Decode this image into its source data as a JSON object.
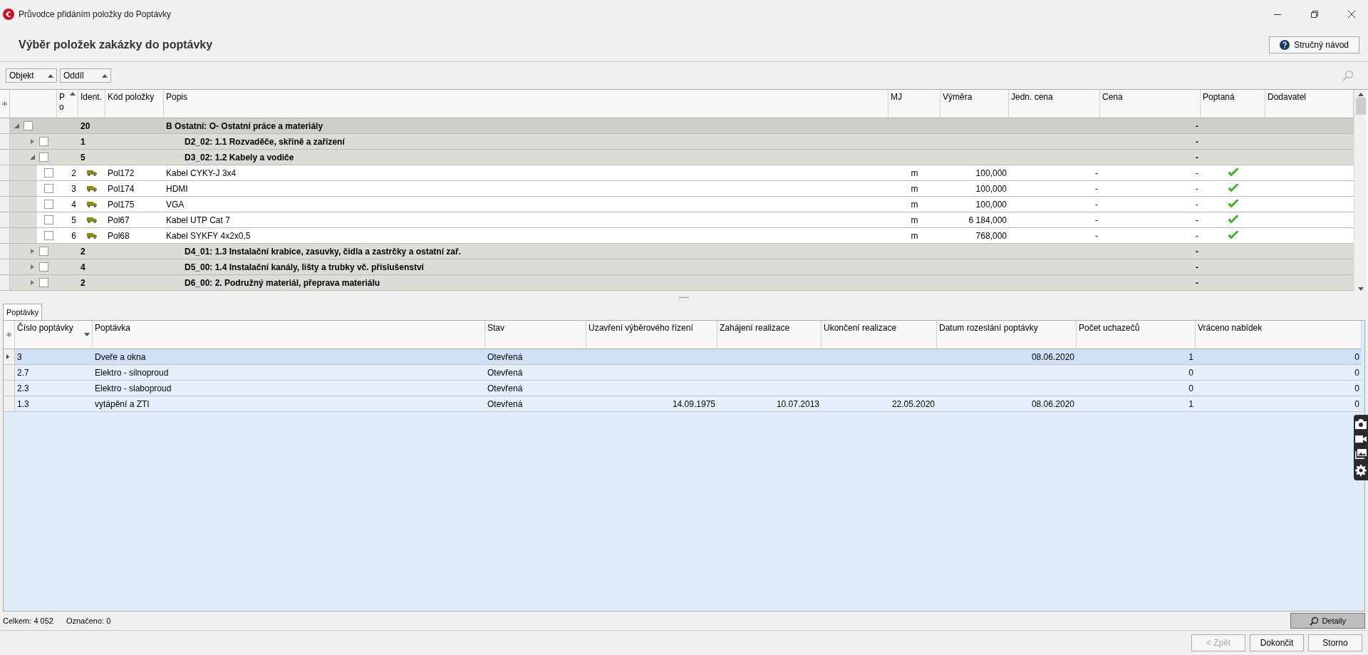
{
  "window": {
    "title": "Průvodce přidáním položky do Poptávky"
  },
  "heading": "Výběr položek zakázky do poptávky",
  "help_button": "Stručný návod",
  "filters": [
    {
      "label": "Objekt"
    },
    {
      "label": "Oddíl"
    }
  ],
  "items_table": {
    "columns": [
      "P o",
      "Ident.",
      "Kód položky",
      "Popis",
      "MJ",
      "Výměra",
      "Jedn. cena",
      "Cena",
      "Poptaná",
      "Dodavatel"
    ],
    "rows": [
      {
        "kind": "group",
        "checked": false,
        "expanded": true,
        "count": "20",
        "popis": "B Ostatní: O- Ostatní práce a materiály",
        "cena": "-",
        "children": [
          {
            "kind": "group",
            "checked": false,
            "expanded": false,
            "count": "1",
            "popis": "D2_02: 1.1 Rozvaděče, skříně a zařízení",
            "cena": "-"
          },
          {
            "kind": "group",
            "checked": false,
            "expanded": true,
            "count": "5",
            "popis": "D3_02: 1.2 Kabely a vodiče",
            "cena": "-",
            "children": [
              {
                "kind": "item",
                "checked": false,
                "po": "2",
                "kod": "Pol172",
                "popis": "Kabel CYKY-J 3x4",
                "mj": "m",
                "vymera": "100,000",
                "jedn_cena": "-",
                "cena": "-",
                "poptana": true
              },
              {
                "kind": "item",
                "checked": false,
                "po": "3",
                "kod": "Pol174",
                "popis": "HDMI",
                "mj": "m",
                "vymera": "100,000",
                "jedn_cena": "-",
                "cena": "-",
                "poptana": true
              },
              {
                "kind": "item",
                "checked": false,
                "po": "4",
                "kod": "Pol175",
                "popis": "VGA",
                "mj": "m",
                "vymera": "100,000",
                "jedn_cena": "-",
                "cena": "-",
                "poptana": true
              },
              {
                "kind": "item",
                "checked": false,
                "po": "5",
                "kod": "Pol67",
                "popis": "Kabel UTP Cat 7",
                "mj": "m",
                "vymera": "6 184,000",
                "jedn_cena": "-",
                "cena": "-",
                "poptana": true
              },
              {
                "kind": "item",
                "checked": false,
                "po": "6",
                "kod": "Pol68",
                "popis": "Kabel SYKFY 4x2x0,5",
                "mj": "m",
                "vymera": "768,000",
                "jedn_cena": "-",
                "cena": "-",
                "poptana": true
              }
            ]
          },
          {
            "kind": "group",
            "checked": false,
            "expanded": false,
            "count": "2",
            "popis": "D4_01: 1.3 Instalační krabice, zasuvky, čidla a zastrčky a ostatní zař.",
            "cena": "-"
          },
          {
            "kind": "group",
            "checked": false,
            "expanded": false,
            "count": "4",
            "popis": "D5_00: 1.4 Instalační kanály, lišty a trubky vč. příslušenství",
            "cena": "-"
          },
          {
            "kind": "group",
            "checked": false,
            "expanded": false,
            "count": "2",
            "popis": "D6_00: 2.  Podružný materiál, přeprava materiálu",
            "cena": "-"
          }
        ]
      }
    ]
  },
  "splitter": ".....",
  "tabs": [
    {
      "label": "Poptávky",
      "selected": true
    }
  ],
  "requests_table": {
    "columns": [
      "Číslo poptávky",
      "Poptávka",
      "Stav",
      "Uzavření výběrového řízení",
      "Zahájení realizace",
      "Ukončení realizace",
      "Datum rozeslání poptávky",
      "Počet uchazečů",
      "Vráceno nabídek"
    ],
    "rows": [
      {
        "selected": true,
        "cells": [
          "3",
          "Dveře a okna",
          "Otevřená",
          "",
          "",
          "",
          "08.06.2020",
          "1",
          "0"
        ]
      },
      {
        "selected": false,
        "cells": [
          "2.7",
          "Elektro - silnoproud",
          "Otevřená",
          "",
          "",
          "",
          "",
          "0",
          "0"
        ]
      },
      {
        "selected": false,
        "cells": [
          "2.3",
          "Elektro - slaboproud",
          "Otevřená",
          "",
          "",
          "",
          "",
          "0",
          "0"
        ]
      },
      {
        "selected": false,
        "cells": [
          "1.3",
          "vytápění a ZTI",
          "Otevřená",
          "14.09.1975",
          "10.07.2013",
          "22.05.2020",
          "08.06.2020",
          "1",
          "0"
        ]
      }
    ]
  },
  "status_bar": {
    "total": "Celkem: 4 052",
    "marked": "Označeno: 0",
    "details_button": "Detaily"
  },
  "buttons": [
    {
      "label": "< Zpět",
      "disabled": true
    },
    {
      "label": "Dokončit",
      "disabled": false
    },
    {
      "label": "Storno",
      "disabled": false
    }
  ]
}
